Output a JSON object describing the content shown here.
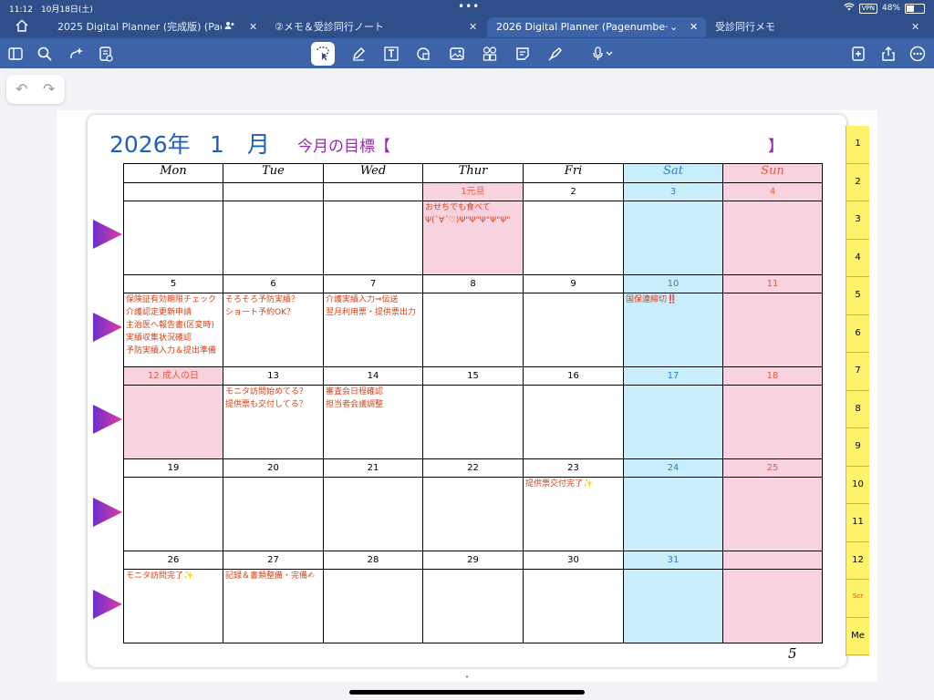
{
  "status": {
    "time": "11:12",
    "date": "10月18日(土)",
    "vpn": "VPN",
    "battery": "48%"
  },
  "tabs": [
    {
      "label": "2025 Digital Planner (完成版) (Pag..."
    },
    {
      "label": "②メモ＆受診同行ノート"
    },
    {
      "label": "2026 Digital Planner (Pagenumbe···",
      "active": true
    },
    {
      "label": "受診同行メモ"
    }
  ],
  "toolbar_icons": [
    "sidebar-icon",
    "search-icon",
    "sparkle-icon",
    "document-icon",
    "lasso-icon",
    "pen-icon",
    "textbox-icon",
    "shapes-icon",
    "image-icon",
    "stickers-icon",
    "note-icon",
    "highlighter-icon",
    "microphone-icon",
    "add-page-icon",
    "share-icon",
    "more-icon"
  ],
  "calendar": {
    "year": "2026年",
    "month": "1　月",
    "goal_label": "今月の目標【",
    "goal_close": "】",
    "days": [
      "Mon",
      "Tue",
      "Wed",
      "Thur",
      "Fri",
      "Sat",
      "Sun"
    ],
    "weeks": [
      {
        "dates": [
          "",
          "",
          "",
          "1元旦",
          "2",
          "3",
          "4"
        ],
        "notes": [
          "",
          "",
          "",
          "おせちでも食べて\nΨ(`∀´♡)Ψ\"Ψ\"Ψ\"Ψ\"Ψ\"",
          "",
          "",
          ""
        ],
        "holidays": [
          false,
          false,
          false,
          true,
          false,
          false,
          false
        ]
      },
      {
        "dates": [
          "5",
          "6",
          "7",
          "8",
          "9",
          "10",
          "11"
        ],
        "notes": [
          "保険証有効期限チェック\n介護認定更新申請\n主治医へ報告書(区変時)\n実績収集状況確認\n予防実績入力＆提出準備",
          "そろそろ予防実績？\nショート予約OK？",
          "介護実績入力⇒伝送\n翌月利用票・提供票出力",
          "",
          "",
          "国保連締切‼️",
          ""
        ],
        "holidays": [
          false,
          false,
          false,
          false,
          false,
          false,
          false
        ]
      },
      {
        "dates": [
          "12 成人の日",
          "13",
          "14",
          "15",
          "16",
          "17",
          "18"
        ],
        "notes": [
          "",
          "モニタ訪問始めてる？\n提供票も交付してる？",
          "審査会日程確認\n担当者会議調整",
          "",
          "",
          "",
          ""
        ],
        "holidays": [
          true,
          false,
          false,
          false,
          false,
          false,
          false
        ]
      },
      {
        "dates": [
          "19",
          "20",
          "21",
          "22",
          "23",
          "24",
          "25"
        ],
        "notes": [
          "",
          "",
          "",
          "",
          "提供票交付完了✨",
          "",
          ""
        ],
        "holidays": [
          false,
          false,
          false,
          false,
          false,
          false,
          false
        ]
      },
      {
        "dates": [
          "26",
          "27",
          "28",
          "29",
          "30",
          "31",
          ""
        ],
        "notes": [
          "モニタ訪問完了✨",
          "記録＆書類整備・完備✍",
          "",
          "",
          "",
          "",
          ""
        ],
        "holidays": [
          false,
          false,
          false,
          false,
          false,
          false,
          false
        ]
      }
    ]
  },
  "side_tabs": [
    "1",
    "2",
    "3",
    "4",
    "5",
    "6",
    "7",
    "8",
    "9",
    "10",
    "11",
    "12",
    "Scr",
    "Me"
  ],
  "page_number": "5",
  "colors": {
    "header_blue": "#1f5fbf",
    "goal_purple": "#9b27b0",
    "sat_blue": "#c9eefb",
    "sun_pink": "#f9d2df",
    "note_red": "#d94118",
    "tab_yellow": "#fef36b"
  }
}
